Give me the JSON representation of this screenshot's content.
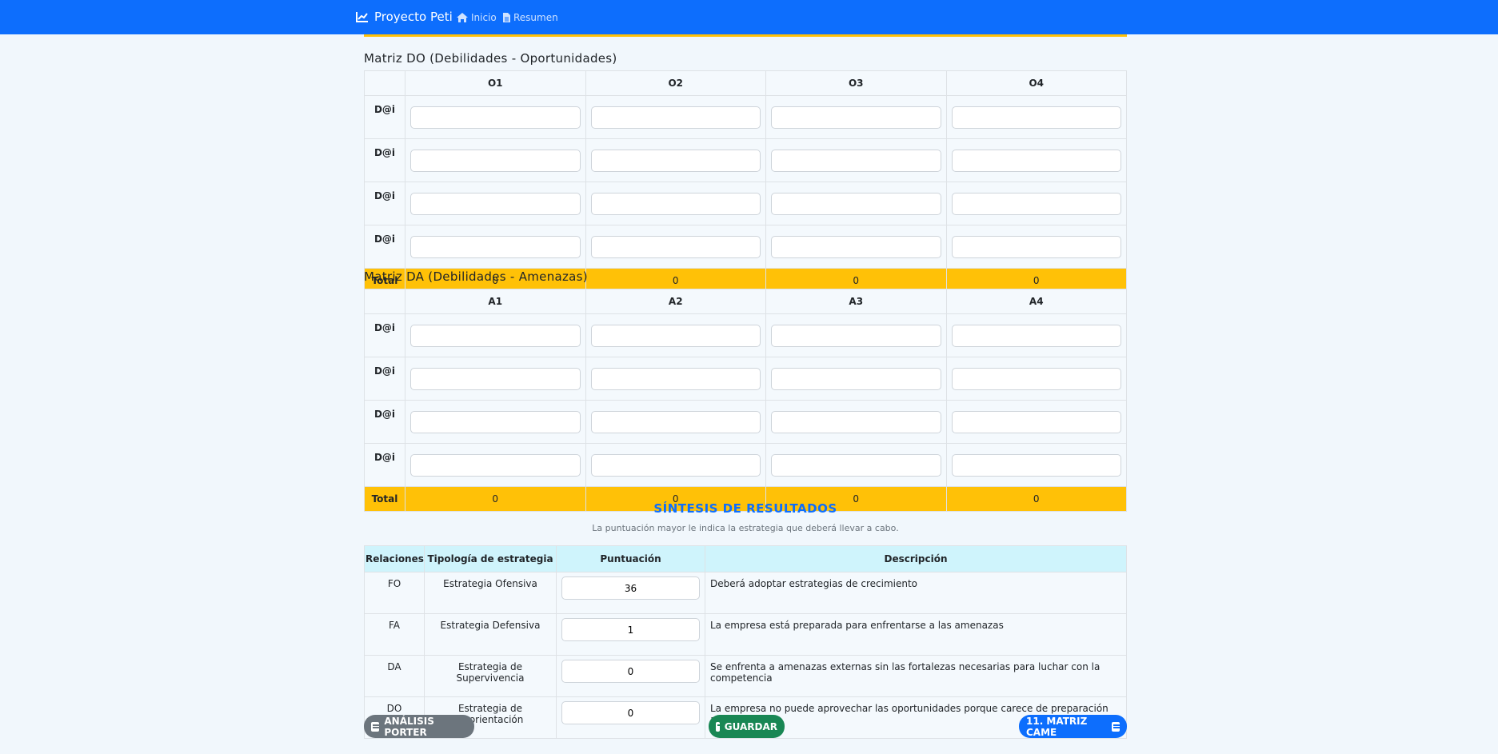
{
  "navbar": {
    "brand": "Proyecto Peti",
    "home": "Inicio",
    "summary": "Resumen"
  },
  "do_matrix": {
    "title": "Matriz DO (Debilidades - Oportunidades)",
    "columns": [
      "O1",
      "O2",
      "O3",
      "O4"
    ],
    "rows": [
      "D@i",
      "D@i",
      "D@i",
      "D@i"
    ],
    "total_label": "Total",
    "totals": [
      "0",
      "0",
      "0",
      "0"
    ]
  },
  "da_matrix": {
    "title": "Matriz DA (Debilidades - Amenazas)",
    "columns": [
      "A1",
      "A2",
      "A3",
      "A4"
    ],
    "rows": [
      "D@i",
      "D@i",
      "D@i",
      "D@i"
    ],
    "total_label": "Total",
    "totals": [
      "0",
      "0",
      "0",
      "0"
    ]
  },
  "synthesis": {
    "title": "SÍNTESIS DE RESULTADOS",
    "subtitle": "La puntuación mayor le indica la estrategia que deberá llevar a cabo.",
    "headers": [
      "Relaciones",
      "Tipología de estrategia",
      "Puntuación",
      "Descripción"
    ],
    "rows": [
      {
        "rel": "FO",
        "type": "Estrategia Ofensiva",
        "score": "36",
        "desc": "Deberá adoptar estrategias de crecimiento"
      },
      {
        "rel": "FA",
        "type": "Estrategia Defensiva",
        "score": "1",
        "desc": "La empresa está preparada para enfrentarse a las amenazas"
      },
      {
        "rel": "DA",
        "type": "Estrategia de Supervivencia",
        "score": "0",
        "desc": "Se enfrenta a amenazas externas sin las fortalezas necesarias para luchar con la competencia"
      },
      {
        "rel": "DO",
        "type": "Estrategia de Reorientación",
        "score": "0",
        "desc": "La empresa no puede aprovechar las oportunidades porque carece de preparación adecuada"
      }
    ]
  },
  "buttons": {
    "back": "ANÁLISIS PORTER",
    "save": "GUARDAR",
    "next": "11. MATRIZ CAME"
  }
}
